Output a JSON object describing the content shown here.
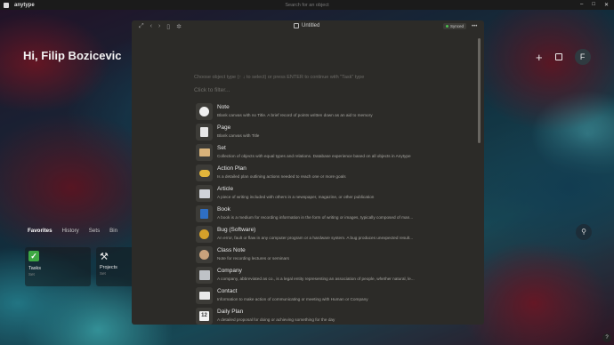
{
  "titlebar": {
    "app_name": "anytype",
    "search_placeholder": "Search for an object",
    "controls": [
      "–",
      "□",
      "✕"
    ]
  },
  "dashboard": {
    "greeting": "Hi, Filip Bozicevic",
    "tabs": [
      {
        "label": "Favorites",
        "active": true
      },
      {
        "label": "History",
        "active": false
      },
      {
        "label": "Sets",
        "active": false
      },
      {
        "label": "Bin",
        "active": false
      }
    ],
    "cards": [
      {
        "name": "Tasks",
        "sub": "Set",
        "icon": "checkmark-icon"
      },
      {
        "name": "Projects",
        "sub": "Set",
        "icon": "hammer-icon"
      }
    ],
    "avatar_letter": "F",
    "plus_glyph": "+",
    "search_glyph": "⚲",
    "help_glyph": "?"
  },
  "popup": {
    "title": "Untitled",
    "synced_label": "Synced",
    "more_glyph": "•••",
    "nav_glyphs": [
      "⤢",
      "‹",
      "›",
      "▯",
      "✲"
    ],
    "hint": "Choose object type (↑ ↓ to select) or press ENTER to continue with \"Task\" type",
    "filter_placeholder": "Click to filter..."
  },
  "types": [
    {
      "name": "Note",
      "desc": "Blank canvas with no Title. A brief record of points written down as an aid to memory",
      "icon": "note-icon",
      "cls": "i-note",
      "glyph": ""
    },
    {
      "name": "Page",
      "desc": "Blank canvas with Title",
      "icon": "page-icon",
      "cls": "i-page",
      "glyph": ""
    },
    {
      "name": "Set",
      "desc": "Collection of objects with equal types and relations. Database experience based on all objects in Anytype",
      "icon": "folder-icon",
      "cls": "i-set",
      "glyph": ""
    },
    {
      "name": "Action Plan",
      "desc": "Is a detailed plan outlining actions needed to reach one or more goals",
      "icon": "handshake-icon",
      "cls": "i-action",
      "glyph": ""
    },
    {
      "name": "Article",
      "desc": "A piece of writing included with others in a newspaper, magazine, or other publication",
      "icon": "newspaper-icon",
      "cls": "i-article",
      "glyph": ""
    },
    {
      "name": "Book",
      "desc": "A book is a medium for recording information in the form of writing or images, typically composed of man...",
      "icon": "book-icon",
      "cls": "i-book",
      "glyph": ""
    },
    {
      "name": "Bug (Software)",
      "desc": "An error, fault or flaw in any computer program or a hardware system. A bug produces unexpected result...",
      "icon": "bug-icon",
      "cls": "i-bug",
      "glyph": ""
    },
    {
      "name": "Class Note",
      "desc": "Note for recording lectures or seminars",
      "icon": "student-icon",
      "cls": "i-class",
      "glyph": ""
    },
    {
      "name": "Company",
      "desc": "A company, abbreviated as co., is a legal entity representing an association of people, whether natural, le...",
      "icon": "building-icon",
      "cls": "i-company",
      "glyph": ""
    },
    {
      "name": "Contact",
      "desc": "Information to make action of communicating or meeting with Human or Company",
      "icon": "contact-card-icon",
      "cls": "i-contact",
      "glyph": ""
    },
    {
      "name": "Daily Plan",
      "desc": "A detailed proposal for doing or achieving something for the day",
      "icon": "calendar-icon",
      "cls": "i-daily",
      "glyph": "12"
    }
  ]
}
